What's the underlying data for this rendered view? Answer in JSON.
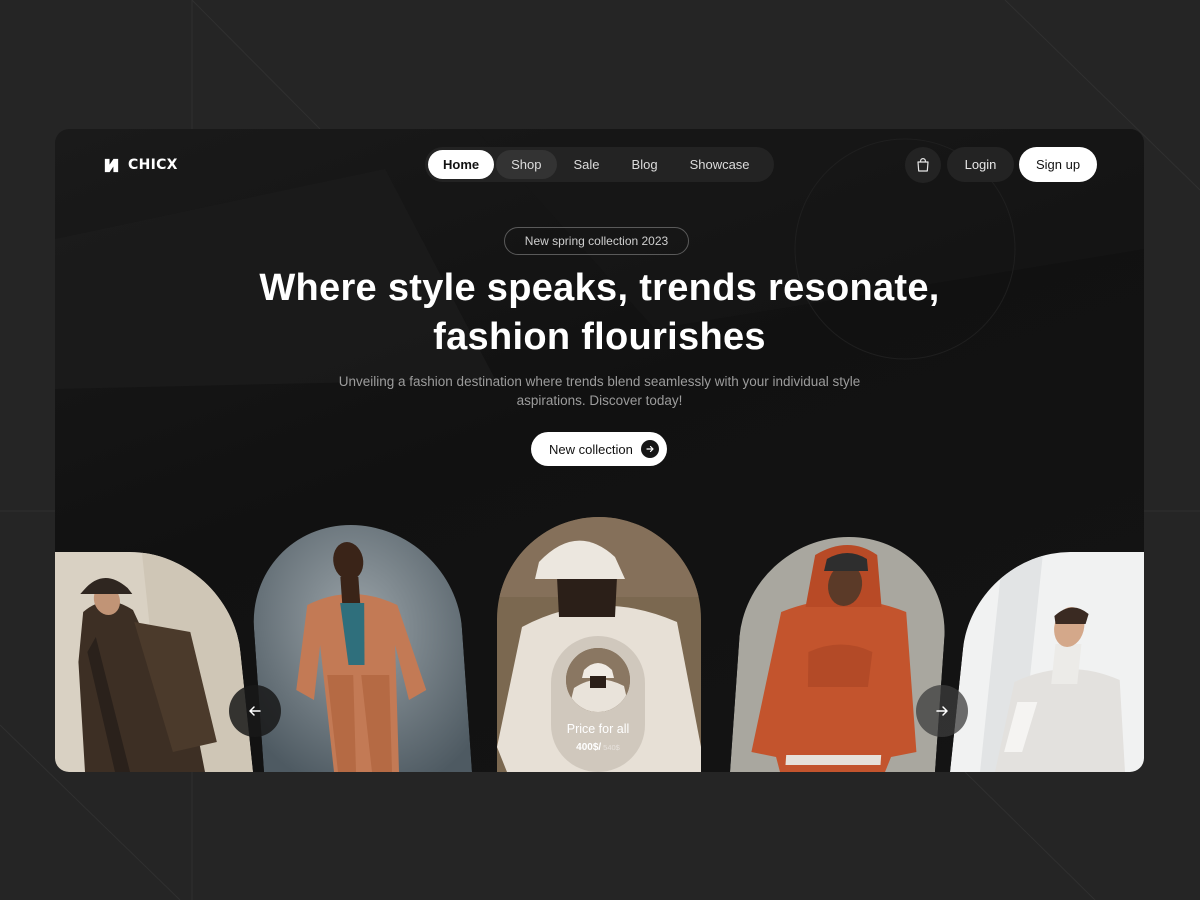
{
  "brand": {
    "name": "CHICX",
    "logo_icon": "chicx-logo-icon"
  },
  "nav": {
    "items": [
      {
        "label": "Home",
        "active": true
      },
      {
        "label": "Shop",
        "active": false
      },
      {
        "label": "Sale",
        "active": false
      },
      {
        "label": "Blog",
        "active": false
      },
      {
        "label": "Showcase",
        "active": false
      }
    ]
  },
  "header_actions": {
    "cart_icon": "shopping-bag-icon",
    "login_label": "Login",
    "signup_label": "Sign up"
  },
  "hero": {
    "badge": "New spring collection 2023",
    "headline_line1": "Where style speaks, trends resonate,",
    "headline_line2": "fashion flourishes",
    "subtitle": "Unveiling a fashion destination where trends blend seamlessly with your individual style aspirations. Discover today!",
    "cta_label": "New collection",
    "cta_icon": "arrow-right-icon"
  },
  "gallery": {
    "price_card": {
      "label": "Price for all",
      "price": "400$/",
      "old_price": "540$"
    },
    "prev_icon": "arrow-left-icon",
    "next_icon": "arrow-right-icon"
  },
  "colors": {
    "page_background": "#252525",
    "frame_background": "#141414",
    "accent": "#ffffff",
    "nav_pill": "#232323"
  }
}
